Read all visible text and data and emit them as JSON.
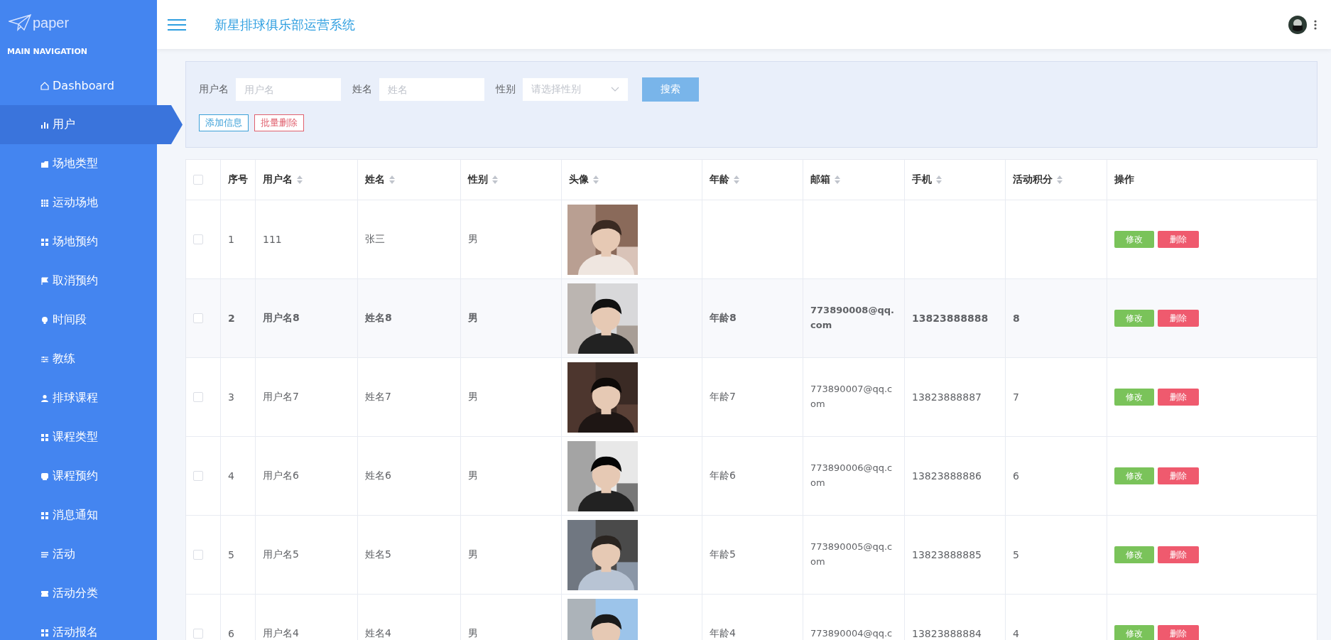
{
  "sidebar": {
    "logo": "paper",
    "section": "MAIN NAVIGATION",
    "items": [
      {
        "label": "Dashboard",
        "selected": false
      },
      {
        "label": "用户",
        "selected": true
      },
      {
        "label": "场地类型",
        "selected": false
      },
      {
        "label": "运动场地",
        "selected": false
      },
      {
        "label": "场地预约",
        "selected": false
      },
      {
        "label": "取消预约",
        "selected": false
      },
      {
        "label": "时间段",
        "selected": false
      },
      {
        "label": "教练",
        "selected": false
      },
      {
        "label": "排球课程",
        "selected": false
      },
      {
        "label": "课程类型",
        "selected": false
      },
      {
        "label": "课程预约",
        "selected": false
      },
      {
        "label": "消息通知",
        "selected": false
      },
      {
        "label": "活动",
        "selected": false
      },
      {
        "label": "活动分类",
        "selected": false
      },
      {
        "label": "活动报名",
        "selected": false
      }
    ]
  },
  "header": {
    "title": "新星排球俱乐部运营系统"
  },
  "search": {
    "fields": [
      {
        "label": "用户名",
        "placeholder": "用户名",
        "kind": "input"
      },
      {
        "label": "姓名",
        "placeholder": "姓名",
        "kind": "input"
      },
      {
        "label": "性别",
        "placeholder": "请选择性别",
        "kind": "select"
      }
    ],
    "search_button": "搜索",
    "add_button": "添加信息",
    "batch_delete_button": "批量删除"
  },
  "table": {
    "all_checked": false,
    "columns": [
      {
        "label": "序号",
        "sortable": false
      },
      {
        "label": "用户名",
        "sortable": true
      },
      {
        "label": "姓名",
        "sortable": true
      },
      {
        "label": "性别",
        "sortable": true
      },
      {
        "label": "头像",
        "sortable": true
      },
      {
        "label": "年龄",
        "sortable": true
      },
      {
        "label": "邮箱",
        "sortable": true
      },
      {
        "label": "手机",
        "sortable": true
      },
      {
        "label": "活动积分",
        "sortable": true
      },
      {
        "label": "操作",
        "sortable": false
      }
    ],
    "rows": [
      {
        "selected": false,
        "highlighted": false,
        "no": "1",
        "username": "111",
        "name": "张三",
        "gender": "男",
        "photo": {
          "kind": "picture"
        },
        "actions": [
          "修改",
          "删除"
        ]
      },
      {
        "selected": false,
        "highlighted": true,
        "no": "2",
        "username": "用户名8",
        "name": "姓名8",
        "gender": "男",
        "photo": {
          "kind": "picture"
        },
        "age": "年龄8",
        "email": "773890008@qq.com",
        "phone": "13823888888",
        "points": "8",
        "actions": [
          "修改",
          "删除"
        ]
      },
      {
        "selected": false,
        "highlighted": false,
        "no": "3",
        "username": "用户名7",
        "name": "姓名7",
        "gender": "男",
        "photo": {
          "kind": "picture"
        },
        "age": "年龄7",
        "email": "773890007@qq.com",
        "phone": "13823888887",
        "points": "7",
        "actions": [
          "修改",
          "删除"
        ]
      },
      {
        "selected": false,
        "highlighted": false,
        "no": "4",
        "username": "用户名6",
        "name": "姓名6",
        "gender": "男",
        "photo": {
          "kind": "picture"
        },
        "age": "年龄6",
        "email": "773890006@qq.com",
        "phone": "13823888886",
        "points": "6",
        "actions": [
          "修改",
          "删除"
        ]
      },
      {
        "selected": false,
        "highlighted": false,
        "no": "5",
        "username": "用户名5",
        "name": "姓名5",
        "gender": "男",
        "photo": {
          "kind": "picture"
        },
        "age": "年龄5",
        "email": "773890005@qq.com",
        "phone": "13823888885",
        "points": "5",
        "actions": [
          "修改",
          "删除"
        ]
      },
      {
        "selected": false,
        "highlighted": false,
        "no": "6",
        "username": "用户名4",
        "name": "姓名4",
        "gender": "男",
        "photo": {
          "kind": "picture"
        },
        "age": "年龄4",
        "email": "773890004@qq.c",
        "phone": "13823888884",
        "points": "4",
        "actions": [
          "修改",
          "删除"
        ]
      }
    ]
  }
}
